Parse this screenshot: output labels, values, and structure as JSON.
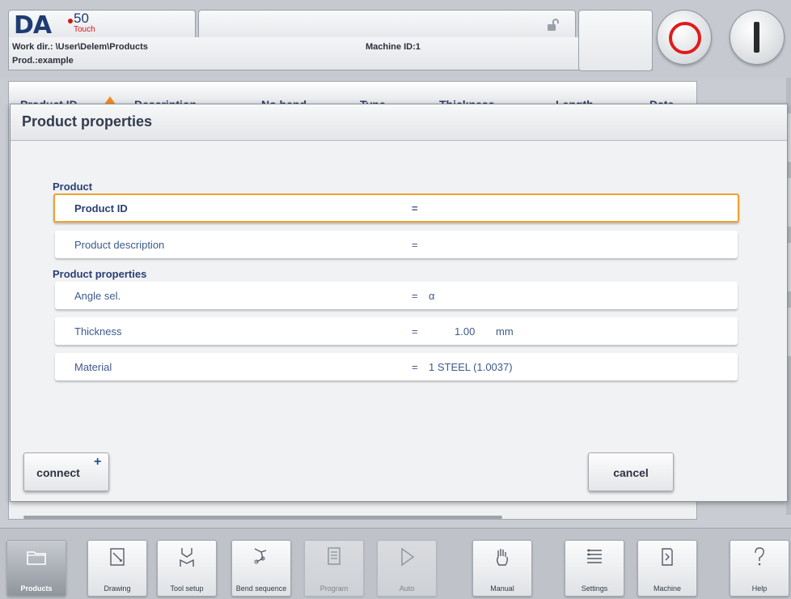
{
  "header": {
    "logo_text": "DA",
    "logo_number": "50",
    "logo_sub": "Touch",
    "work_dir": "Work dir.: \\User\\Delem\\Products",
    "machine_id": "Machine ID:1",
    "product": "Prod.:example",
    "lock_icon": "unlocked-padlock-icon",
    "stop_icon": "stop-circle-icon",
    "start_icon": "start-bar-icon",
    "stop_color": "#e01b1b"
  },
  "product_list": {
    "columns": [
      "Product ID",
      "Description",
      "No bend",
      "Type",
      "Thickness",
      "Length",
      "Date"
    ],
    "sort_icon": "sort-ascending-icon"
  },
  "dialog": {
    "title": "Product properties",
    "section_product": "Product",
    "section_properties": "Product properties",
    "fields": [
      {
        "label": "Product ID",
        "eq": "=",
        "value": "",
        "unit": ""
      },
      {
        "label": "Product description",
        "eq": "=",
        "value": "",
        "unit": ""
      },
      {
        "label": "Angle sel.",
        "eq": "=",
        "value": "α",
        "unit": ""
      },
      {
        "label": "Thickness",
        "eq": "=",
        "value": "1.00",
        "unit": "mm"
      },
      {
        "label": "Material",
        "eq": "=",
        "value": "1 STEEL (1.0037)",
        "unit": ""
      }
    ],
    "connect_label": "connect",
    "connect_plus": "+",
    "cancel_label": "cancel",
    "focus_color": "#f0a030"
  },
  "navbar": {
    "items": [
      {
        "label": "Products",
        "icon": "folder-icon"
      },
      {
        "label": "Drawing",
        "icon": "pencil-icon"
      },
      {
        "label": "Tool setup",
        "icon": "tool-icon"
      },
      {
        "label": "Bend sequence",
        "icon": "bend-sequence-icon"
      },
      {
        "label": "Program",
        "icon": "program-icon"
      },
      {
        "label": "Auto",
        "icon": "play-icon"
      },
      {
        "label": "Manual",
        "icon": "hand-icon"
      },
      {
        "label": "Settings",
        "icon": "list-settings-icon"
      },
      {
        "label": "Machine",
        "icon": "machine-icon"
      },
      {
        "label": "Help",
        "icon": "question-icon"
      }
    ]
  }
}
